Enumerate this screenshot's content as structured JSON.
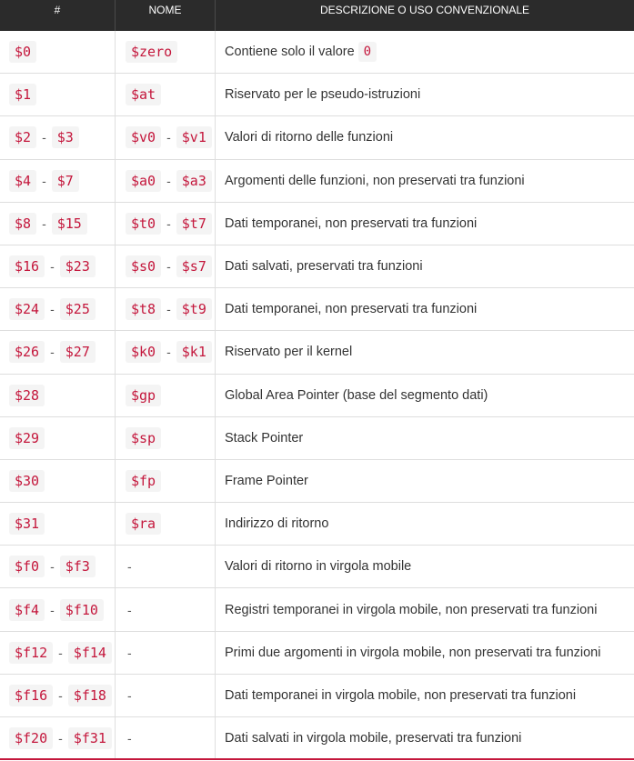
{
  "header": {
    "col1": "#",
    "col2": "NOME",
    "col3": "DESCRIZIONE O USO CONVENZIONALE"
  },
  "separator": "-",
  "rows": [
    {
      "num": [
        "$0"
      ],
      "name": [
        "$zero"
      ],
      "desc": "Contiene solo il valore",
      "desc_code": "0"
    },
    {
      "num": [
        "$1"
      ],
      "name": [
        "$at"
      ],
      "desc": "Riservato per le pseudo-istruzioni"
    },
    {
      "num": [
        "$2",
        "$3"
      ],
      "name": [
        "$v0",
        "$v1"
      ],
      "desc": "Valori di ritorno delle funzioni"
    },
    {
      "num": [
        "$4",
        "$7"
      ],
      "name": [
        "$a0",
        "$a3"
      ],
      "desc": "Argomenti delle funzioni, non preservati tra funzioni"
    },
    {
      "num": [
        "$8",
        "$15"
      ],
      "name": [
        "$t0",
        "$t7"
      ],
      "desc": "Dati temporanei, non preservati tra funzioni"
    },
    {
      "num": [
        "$16",
        "$23"
      ],
      "name": [
        "$s0",
        "$s7"
      ],
      "desc": "Dati salvati, preservati tra funzioni"
    },
    {
      "num": [
        "$24",
        "$25"
      ],
      "name": [
        "$t8",
        "$t9"
      ],
      "desc": "Dati temporanei, non preservati tra funzioni"
    },
    {
      "num": [
        "$26",
        "$27"
      ],
      "name": [
        "$k0",
        "$k1"
      ],
      "desc": "Riservato per il kernel"
    },
    {
      "num": [
        "$28"
      ],
      "name": [
        "$gp"
      ],
      "desc": "Global Area Pointer (base del segmento dati)"
    },
    {
      "num": [
        "$29"
      ],
      "name": [
        "$sp"
      ],
      "desc": "Stack Pointer"
    },
    {
      "num": [
        "$30"
      ],
      "name": [
        "$fp"
      ],
      "desc": "Frame Pointer"
    },
    {
      "num": [
        "$31"
      ],
      "name": [
        "$ra"
      ],
      "desc": "Indirizzo di ritorno"
    },
    {
      "num": [
        "$f0",
        "$f3"
      ],
      "name": [],
      "desc": "Valori di ritorno in virgola mobile"
    },
    {
      "num": [
        "$f4",
        "$f10"
      ],
      "name": [],
      "desc": "Registri temporanei in virgola mobile, non preservati tra funzioni"
    },
    {
      "num": [
        "$f12",
        "$f14"
      ],
      "name": [],
      "desc": "Primi due argomenti in virgola mobile, non preservati tra funzioni"
    },
    {
      "num": [
        "$f16",
        "$f18"
      ],
      "name": [],
      "desc": "Dati temporanei in virgola mobile, non preservati tra funzioni"
    },
    {
      "num": [
        "$f20",
        "$f31"
      ],
      "name": [],
      "desc": "Dati salvati in virgola mobile, preservati tra funzioni"
    }
  ]
}
